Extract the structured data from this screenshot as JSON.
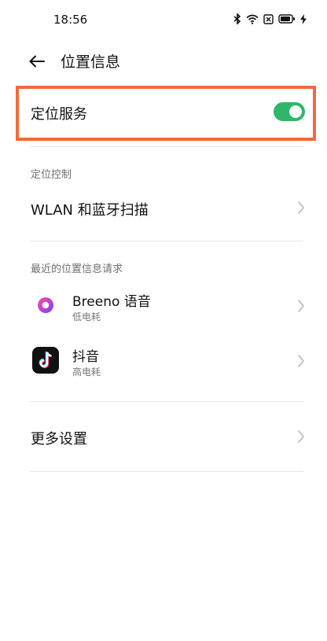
{
  "status_bar": {
    "time": "18:56",
    "icons": [
      "bluetooth-icon",
      "wifi-icon",
      "sim-blocked-icon",
      "battery-icon",
      "charging-icon"
    ]
  },
  "header": {
    "back_icon": "arrow-left-icon",
    "title": "位置信息"
  },
  "location_service": {
    "label": "定位服务",
    "enabled": true,
    "toggle_color": "#2fb769",
    "highlight_color": "#f26a3a"
  },
  "location_control": {
    "section_title": "定位控制",
    "wlan_label": "WLAN 和蓝牙扫描"
  },
  "recent_requests": {
    "section_title": "最近的位置信息请求",
    "apps": [
      {
        "name": "Breeno 语音",
        "usage": "低电耗",
        "icon": "breeno-icon"
      },
      {
        "name": "抖音",
        "usage": "高电耗",
        "icon": "douyin-icon"
      }
    ]
  },
  "more": {
    "label": "更多设置"
  }
}
